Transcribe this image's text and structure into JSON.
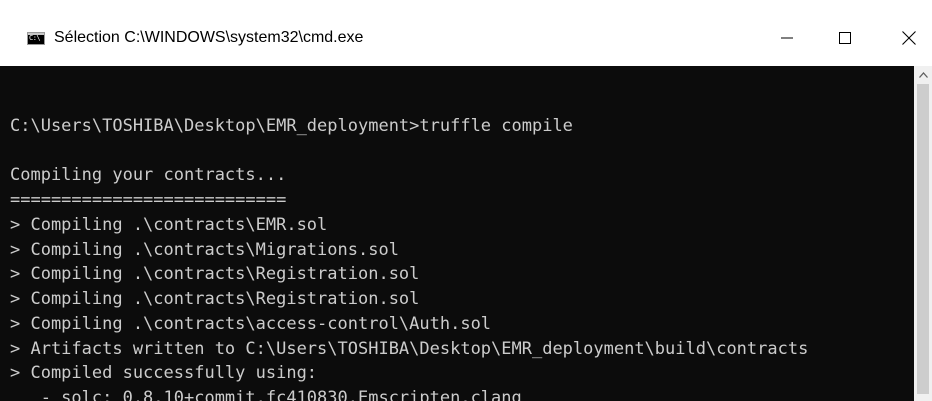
{
  "window": {
    "title": "Sélection C:\\WINDOWS\\system32\\cmd.exe",
    "icon": "cmd-icon",
    "icon_text": "C:\\",
    "controls": {
      "minimize": "minimize-icon",
      "maximize": "maximize-icon",
      "close": "close-icon"
    }
  },
  "console": {
    "colors": {
      "background": "#0c0c0c",
      "text": "#cccccc"
    },
    "lines": [
      "",
      "C:\\Users\\TOSHIBA\\Desktop\\EMR_deployment>truffle compile",
      "",
      "Compiling your contracts...",
      "===========================",
      "> Compiling .\\contracts\\EMR.sol",
      "> Compiling .\\contracts\\Migrations.sol",
      "> Compiling .\\contracts\\Registration.sol",
      "> Compiling .\\contracts\\Registration.sol",
      "> Compiling .\\contracts\\access-control\\Auth.sol",
      "> Artifacts written to C:\\Users\\TOSHIBA\\Desktop\\EMR_deployment\\build\\contracts",
      "> Compiled successfully using:",
      "   - solc: 0.8.10+commit.fc410830.Emscripten.clang"
    ]
  },
  "scrollbar": {
    "up_icon": "scroll-up-arrow-icon"
  }
}
